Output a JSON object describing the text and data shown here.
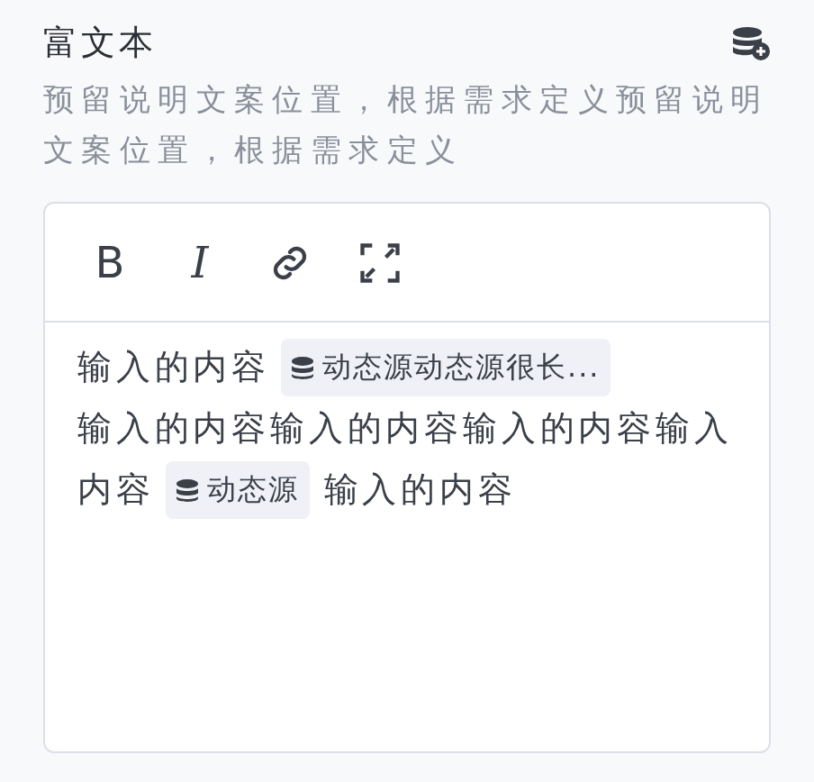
{
  "title": "富文本",
  "description": "预留说明文案位置，根据需求定义预留说明文案位置，根据需求定义",
  "toolbar": [
    {
      "kind": "bold",
      "label": "B"
    },
    {
      "kind": "italic",
      "label": "I"
    },
    {
      "kind": "link"
    },
    {
      "kind": "fullscreen"
    }
  ],
  "content": [
    [
      {
        "kind": "text",
        "text": "输入的内容"
      },
      {
        "kind": "chip",
        "text": "动态源动态源很长..."
      }
    ],
    [
      {
        "kind": "text",
        "text": "输入的内容输入的内容输入的内容输入"
      }
    ],
    [
      {
        "kind": "text",
        "text": "内容"
      },
      {
        "kind": "chip",
        "text": "动态源"
      },
      {
        "kind": "text",
        "text": "输入的内容"
      }
    ]
  ]
}
